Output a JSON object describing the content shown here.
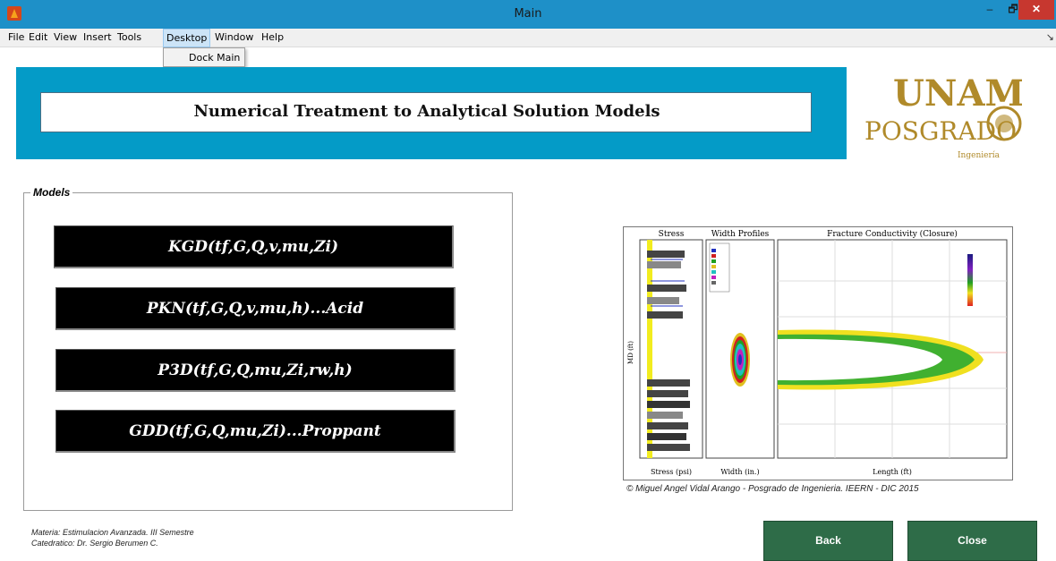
{
  "window": {
    "title": "Main",
    "minimize": "–",
    "maximize": "🗗",
    "close": "✕"
  },
  "menu": {
    "items": [
      "File",
      "Edit",
      "View",
      "Insert",
      "Tools",
      "Desktop",
      "Window",
      "Help"
    ],
    "active": "Desktop",
    "dropdown_item": "Dock Main",
    "corner_glyph": "↘"
  },
  "banner": {
    "title": "Numerical Treatment to Analytical Solution Models",
    "color": "#049bc7"
  },
  "logo": {
    "line1": "UNAM",
    "line2": "POSGRADO",
    "line3": "Ingeniería",
    "color": "#b08a2a"
  },
  "models": {
    "legend": "Models",
    "buttons": [
      "KGD(tf,G,Q,v,mu,Zi)",
      "PKN(tf,G,Q,v,mu,h)...Acid",
      "P3D(tf,G,Q,mu,Zi,rw,h)",
      "GDD(tf,G,Q,mu,Zi)...Proppant"
    ]
  },
  "figure": {
    "panel_titles": [
      "Stress",
      "Width Profiles",
      "Fracture Conductivity (Closure)"
    ],
    "x_labels": [
      "Stress (psi)",
      "Width (in.)",
      "Length (ft)"
    ],
    "y_label": "MD (ft)",
    "icons": [
      "stress-profile-plot",
      "width-profile-plot",
      "conductivity-contour-plot"
    ]
  },
  "caption": "© Miguel Angel Vidal Arango - Posgrado de Ingenieria. IEERN - DIC 2015",
  "footer": {
    "line1": "Materia: Estimulacion Avanzada. III Semestre",
    "line2": "Catedratico: Dr. Sergio Berumen C."
  },
  "actions": {
    "back": "Back",
    "close": "Close",
    "color": "#2e6c48"
  }
}
